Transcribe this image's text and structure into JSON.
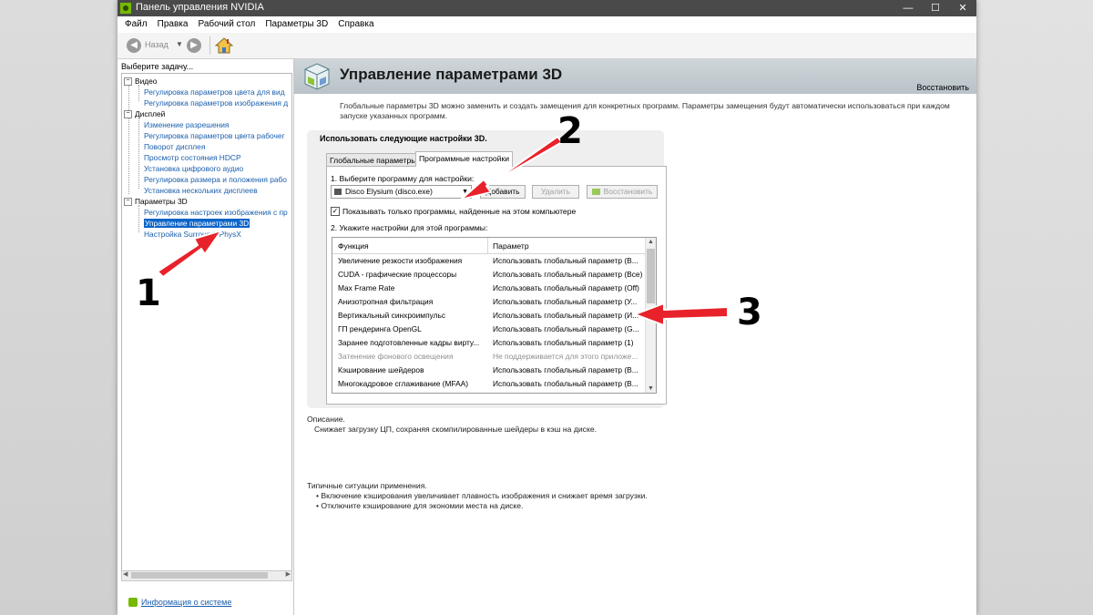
{
  "window": {
    "title": "Панель управления NVIDIA",
    "controls": {
      "minimize": "—",
      "maximize": "☐",
      "close": "✕"
    }
  },
  "menu": [
    "Файл",
    "Правка",
    "Рабочий стол",
    "Параметры 3D",
    "Справка"
  ],
  "toolbar": {
    "back_label": "Назад"
  },
  "left_panel": {
    "task_label": "Выберите задачу...",
    "tree": {
      "video": {
        "label": "Видео",
        "items": [
          "Регулировка параметров цвета для вид",
          "Регулировка параметров изображения д"
        ]
      },
      "display": {
        "label": "Дисплей",
        "items": [
          "Изменение разрешения",
          "Регулировка параметров цвета рабочег",
          "Поворот дисплея",
          "Просмотр состояния HDCP",
          "Установка цифрового аудио",
          "Регулировка размера и положения рабо",
          "Установка нескольких дисплеев"
        ]
      },
      "params3d": {
        "label": "Параметры 3D",
        "items": [
          "Регулировка настроек изображения с пр",
          "Управление параметрами 3D",
          "Настройка Surround, PhysX"
        ],
        "selected_index": 1
      }
    },
    "system_info": "Информация о системе"
  },
  "main": {
    "title": "Управление параметрами 3D",
    "restore": "Восстановить",
    "description": "Глобальные параметры 3D можно заменить и создать замещения для конкретных программ. Параметры замещения будут автоматически использоваться при каждом запуске указанных программ.",
    "group_title": "Использовать следующие настройки 3D.",
    "tabs": [
      "Глобальные параметры",
      "Программные настройки"
    ],
    "step1": "1. Выберите программу для настройки:",
    "program": "Disco Elysium (disco.exe)",
    "buttons": {
      "add": "Добавить",
      "remove": "Удалить",
      "restore": "Восстановить"
    },
    "checkbox": {
      "label": "Показывать только программы, найденные на этом компьютере",
      "checked": true
    },
    "step2": "2. Укажите настройки для этой программы:",
    "table": {
      "headers": [
        "Функция",
        "Параметр"
      ],
      "rows": [
        {
          "f": "Увеличение резкости изображения",
          "p": "Использовать глобальный параметр (В..."
        },
        {
          "f": "CUDA - графические процессоры",
          "p": "Использовать глобальный параметр (Все)"
        },
        {
          "f": "Max Frame Rate",
          "p": "Использовать глобальный параметр (Off)"
        },
        {
          "f": "Анизотропная фильтрация",
          "p": "Использовать глобальный параметр (У..."
        },
        {
          "f": "Вертикальный синхроимпульс",
          "p": "Использовать глобальный параметр (И..."
        },
        {
          "f": "ГП рендеринга OpenGL",
          "p": "Использовать глобальный параметр (G..."
        },
        {
          "f": "Заранее подготовленные кадры вирту...",
          "p": "Использовать глобальный параметр (1)"
        },
        {
          "f": "Затенение фонового освещения",
          "p": "Не поддерживается для этого приложе...",
          "disabled": true
        },
        {
          "f": "Кэширование шейдеров",
          "p": "Использовать глобальный параметр (В..."
        },
        {
          "f": "Многокадровое сглаживание (MFAA)",
          "p": "Использовать глобальный параметр (В..."
        }
      ]
    },
    "desc_label": "Описание.",
    "desc_text": "Снижает загрузку ЦП, сохраняя скомпилированные шейдеры в кэш на диске.",
    "usage_label": "Типичные ситуации применения.",
    "usage": [
      "Включение кэширования увеличивает плавность изображения и снижает время загрузки.",
      "Отключите кэширование для экономии места на диске."
    ]
  },
  "annotations": [
    "1",
    "2",
    "3"
  ],
  "colors": {
    "arrow": "#e8222a",
    "link": "#1b5fad",
    "selection": "#0a64c8",
    "nvidia": "#76b900"
  }
}
